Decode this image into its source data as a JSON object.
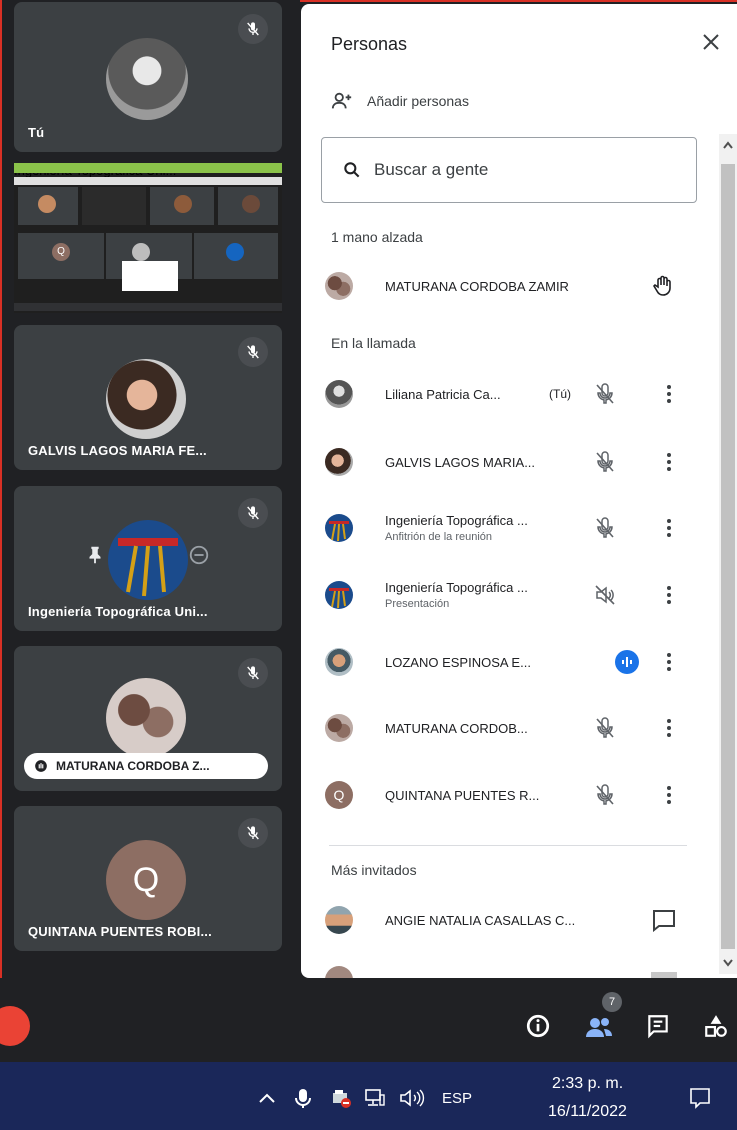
{
  "tiles": {
    "self": {
      "name": "Tú"
    },
    "screenshare": {
      "name": "Ingeniería Topográfica Uni..."
    },
    "galvis": {
      "name": "GALVIS LAGOS MARIA FE..."
    },
    "ingenieria": {
      "name": "Ingeniería Topográfica Uni..."
    },
    "maturana": {
      "name": "MATURANA CORDOBA Z..."
    },
    "quintana": {
      "name": "QUINTANA PUENTES ROBI...",
      "initial": "Q"
    }
  },
  "panel": {
    "title": "Personas",
    "add_people": "Añadir personas",
    "search_placeholder": "Buscar a gente",
    "raised_hands_label": "1 mano alzada",
    "raised": {
      "name": "MATURANA CORDOBA ZAMIR"
    },
    "in_call_label": "En la llamada",
    "participants": [
      {
        "name": "Liliana Patricia Ca...",
        "you": "(Tú)"
      },
      {
        "name": "GALVIS LAGOS MARIA..."
      },
      {
        "name": "Ingeniería Topográfica ...",
        "sub": "Anfitrión de la reunión"
      },
      {
        "name": "Ingeniería Topográfica ...",
        "sub": "Presentación"
      },
      {
        "name": "LOZANO ESPINOSA E..."
      },
      {
        "name": "MATURANA CORDOB..."
      },
      {
        "name": "QUINTANA PUENTES R...",
        "initial": "Q"
      }
    ],
    "more_invited_label": "Más invitados",
    "invited": [
      {
        "name": "ANGIE NATALIA CASALLAS C..."
      }
    ]
  },
  "bottombar": {
    "people_count": "7"
  },
  "taskbar": {
    "language": "ESP",
    "time": "2:33 p. m.",
    "date": "16/11/2022"
  },
  "colors": {
    "accent": "#1a73e8",
    "tile_bg": "#3c4043",
    "taskbar": "#1a2759"
  }
}
